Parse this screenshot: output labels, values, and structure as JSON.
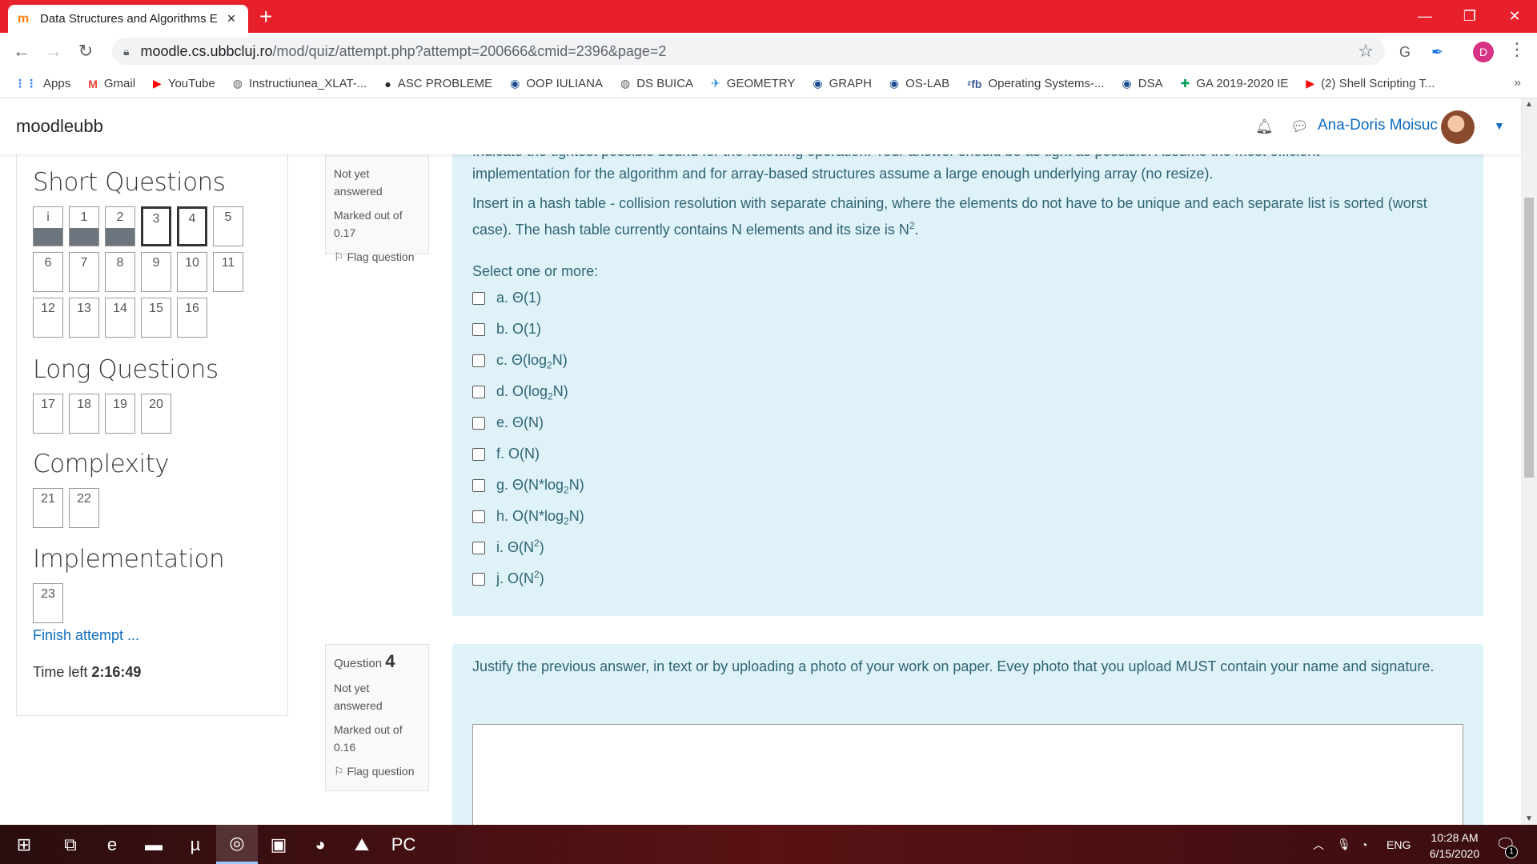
{
  "browser": {
    "tab_title": "Data Structures and Algorithms E",
    "tab_favicon": "moodle-icon",
    "new_tab": "+",
    "url_host": "moodle.cs.ubbcluj.ro",
    "url_path": "/mod/quiz/attempt.php?attempt=200666&cmid=2396&page=2",
    "profile_letter": "D",
    "bookmarks": [
      {
        "icon": "apps-icon",
        "glyph": "⋮⋮",
        "label": "Apps",
        "color": "#4285f4"
      },
      {
        "icon": "gmail-icon",
        "glyph": "M",
        "label": "Gmail",
        "color": "#ea4335"
      },
      {
        "icon": "youtube-icon",
        "glyph": "▶",
        "label": "YouTube",
        "color": "#ff0000"
      },
      {
        "icon": "globe-icon",
        "glyph": "◍",
        "label": "Instructiunea_XLAT-...",
        "color": "#5f6368"
      },
      {
        "icon": "github-icon",
        "glyph": "●",
        "label": "ASC PROBLEME",
        "color": "#24292e"
      },
      {
        "icon": "blue-circle-icon",
        "glyph": "◉",
        "label": "OOP IULIANA",
        "color": "#1a4c8c"
      },
      {
        "icon": "globe-icon",
        "glyph": "◍",
        "label": "DS BUICA",
        "color": "#5f6368"
      },
      {
        "icon": "bird-icon",
        "glyph": "✈",
        "label": "GEOMETRY",
        "color": "#1e88e5"
      },
      {
        "icon": "blue-circle-icon",
        "glyph": "◉",
        "label": "GRAPH",
        "color": "#1a4c8c"
      },
      {
        "icon": "blue-circle-icon",
        "glyph": "◉",
        "label": "OS-LAB",
        "color": "#1a4c8c"
      },
      {
        "icon": "xfb-icon",
        "glyph": "ᶻfb",
        "label": "Operating Systems-...",
        "color": "#3b5998"
      },
      {
        "icon": "blue-circle-icon",
        "glyph": "◉",
        "label": "DSA",
        "color": "#1a4c8c"
      },
      {
        "icon": "green-plus-icon",
        "glyph": "✚",
        "label": "GA 2019-2020 IE",
        "color": "#0f9d58"
      },
      {
        "icon": "youtube-icon",
        "glyph": "▶",
        "label": "(2) Shell Scripting T...",
        "color": "#ff0000"
      }
    ],
    "bookmarks_more": "»"
  },
  "navbar": {
    "brand": "moodleubb",
    "username": "Ana-Doris Moisuc"
  },
  "quiz_nav": {
    "sections": [
      {
        "title": "Short Questions",
        "top": 0,
        "buttons": [
          {
            "n": "i",
            "state": "answered"
          },
          {
            "n": "1",
            "state": "answered"
          },
          {
            "n": "2",
            "state": "answered"
          },
          {
            "n": "3",
            "state": "current"
          },
          {
            "n": "4",
            "state": "current"
          },
          {
            "n": "5",
            "state": ""
          },
          {
            "n": "6",
            "state": ""
          },
          {
            "n": "7",
            "state": ""
          },
          {
            "n": "8",
            "state": ""
          },
          {
            "n": "9",
            "state": ""
          },
          {
            "n": "10",
            "state": ""
          },
          {
            "n": "11",
            "state": ""
          },
          {
            "n": "12",
            "state": ""
          },
          {
            "n": "13",
            "state": ""
          },
          {
            "n": "14",
            "state": ""
          },
          {
            "n": "15",
            "state": ""
          },
          {
            "n": "16",
            "state": ""
          }
        ]
      },
      {
        "title": "Long Questions",
        "buttons": [
          {
            "n": "17",
            "state": ""
          },
          {
            "n": "18",
            "state": ""
          },
          {
            "n": "19",
            "state": ""
          },
          {
            "n": "20",
            "state": ""
          }
        ]
      },
      {
        "title": "Complexity",
        "buttons": [
          {
            "n": "21",
            "state": ""
          },
          {
            "n": "22",
            "state": ""
          }
        ]
      },
      {
        "title": "Implementation",
        "buttons": [
          {
            "n": "23",
            "state": ""
          }
        ]
      }
    ],
    "finish_link": "Finish attempt ...",
    "time_left_label": "Time left ",
    "time_left_value": "2:16:49"
  },
  "question3": {
    "status": "Not yet answered",
    "marked": "Marked out of 0.17",
    "flag": "Flag question",
    "intro_line1": "Indicate the tightest possible bound for the following operation. Your answer should be as tight as possible. Assume the most efficient",
    "intro_line2": "implementation for the algorithm and for array-based structures assume a large enough underlying array (no resize).",
    "text": "Insert in a hash table - collision resolution with separate chaining, where the elements do not have to be unique and each separate list is sorted (worst case). The hash table currently contains N elements and its size is N",
    "text_sup": "2",
    "text_end": ".",
    "prompt": "Select one or more:",
    "options": [
      {
        "pre": "a. Θ(1)",
        "sub": "",
        "post": "",
        "sup": "",
        "end": ""
      },
      {
        "pre": "b. O(1)",
        "sub": "",
        "post": "",
        "sup": "",
        "end": ""
      },
      {
        "pre": "c. Θ(log",
        "sub": "2",
        "post": "N)",
        "sup": "",
        "end": ""
      },
      {
        "pre": "d. O(log",
        "sub": "2",
        "post": "N)",
        "sup": "",
        "end": ""
      },
      {
        "pre": "e. Θ(N)",
        "sub": "",
        "post": "",
        "sup": "",
        "end": ""
      },
      {
        "pre": "f. O(N)",
        "sub": "",
        "post": "",
        "sup": "",
        "end": ""
      },
      {
        "pre": "g. Θ(N*log",
        "sub": "2",
        "post": "N)",
        "sup": "",
        "end": ""
      },
      {
        "pre": "h. O(N*log",
        "sub": "2",
        "post": "N)",
        "sup": "",
        "end": ""
      },
      {
        "pre": "i. Θ(N",
        "sub": "",
        "post": "",
        "sup": "2",
        "end": ")"
      },
      {
        "pre": "j. O(N",
        "sub": "",
        "post": "",
        "sup": "2",
        "end": ")"
      }
    ]
  },
  "question4": {
    "label": "Question ",
    "number": "4",
    "status": "Not yet answered",
    "marked": "Marked out of 0.16",
    "flag": "Flag question",
    "text": "Justify the previous answer, in text or by uploading a photo of your work on paper. Evey photo that you upload MUST contain your name and signature."
  },
  "taskbar": {
    "apps": [
      {
        "name": "start-icon",
        "glyph": "⊞",
        "active": false
      },
      {
        "name": "task-view-icon",
        "glyph": "⧉",
        "active": false
      },
      {
        "name": "edge-icon",
        "glyph": "e",
        "active": false
      },
      {
        "name": "file-explorer-icon",
        "glyph": "▬",
        "active": false
      },
      {
        "name": "utorrent-icon",
        "glyph": "µ",
        "active": false
      },
      {
        "name": "chrome-icon",
        "glyph": "◎",
        "active": true
      },
      {
        "name": "media-icon",
        "glyph": "▣",
        "active": false
      },
      {
        "name": "discord-icon",
        "glyph": "◕",
        "active": false
      },
      {
        "name": "photos-icon",
        "glyph": "⛰",
        "active": false
      },
      {
        "name": "pycharm-icon",
        "glyph": "PC",
        "active": false
      }
    ],
    "language": "ENG",
    "time": "10:28 AM",
    "date": "6/15/2020",
    "notifications": "1"
  }
}
